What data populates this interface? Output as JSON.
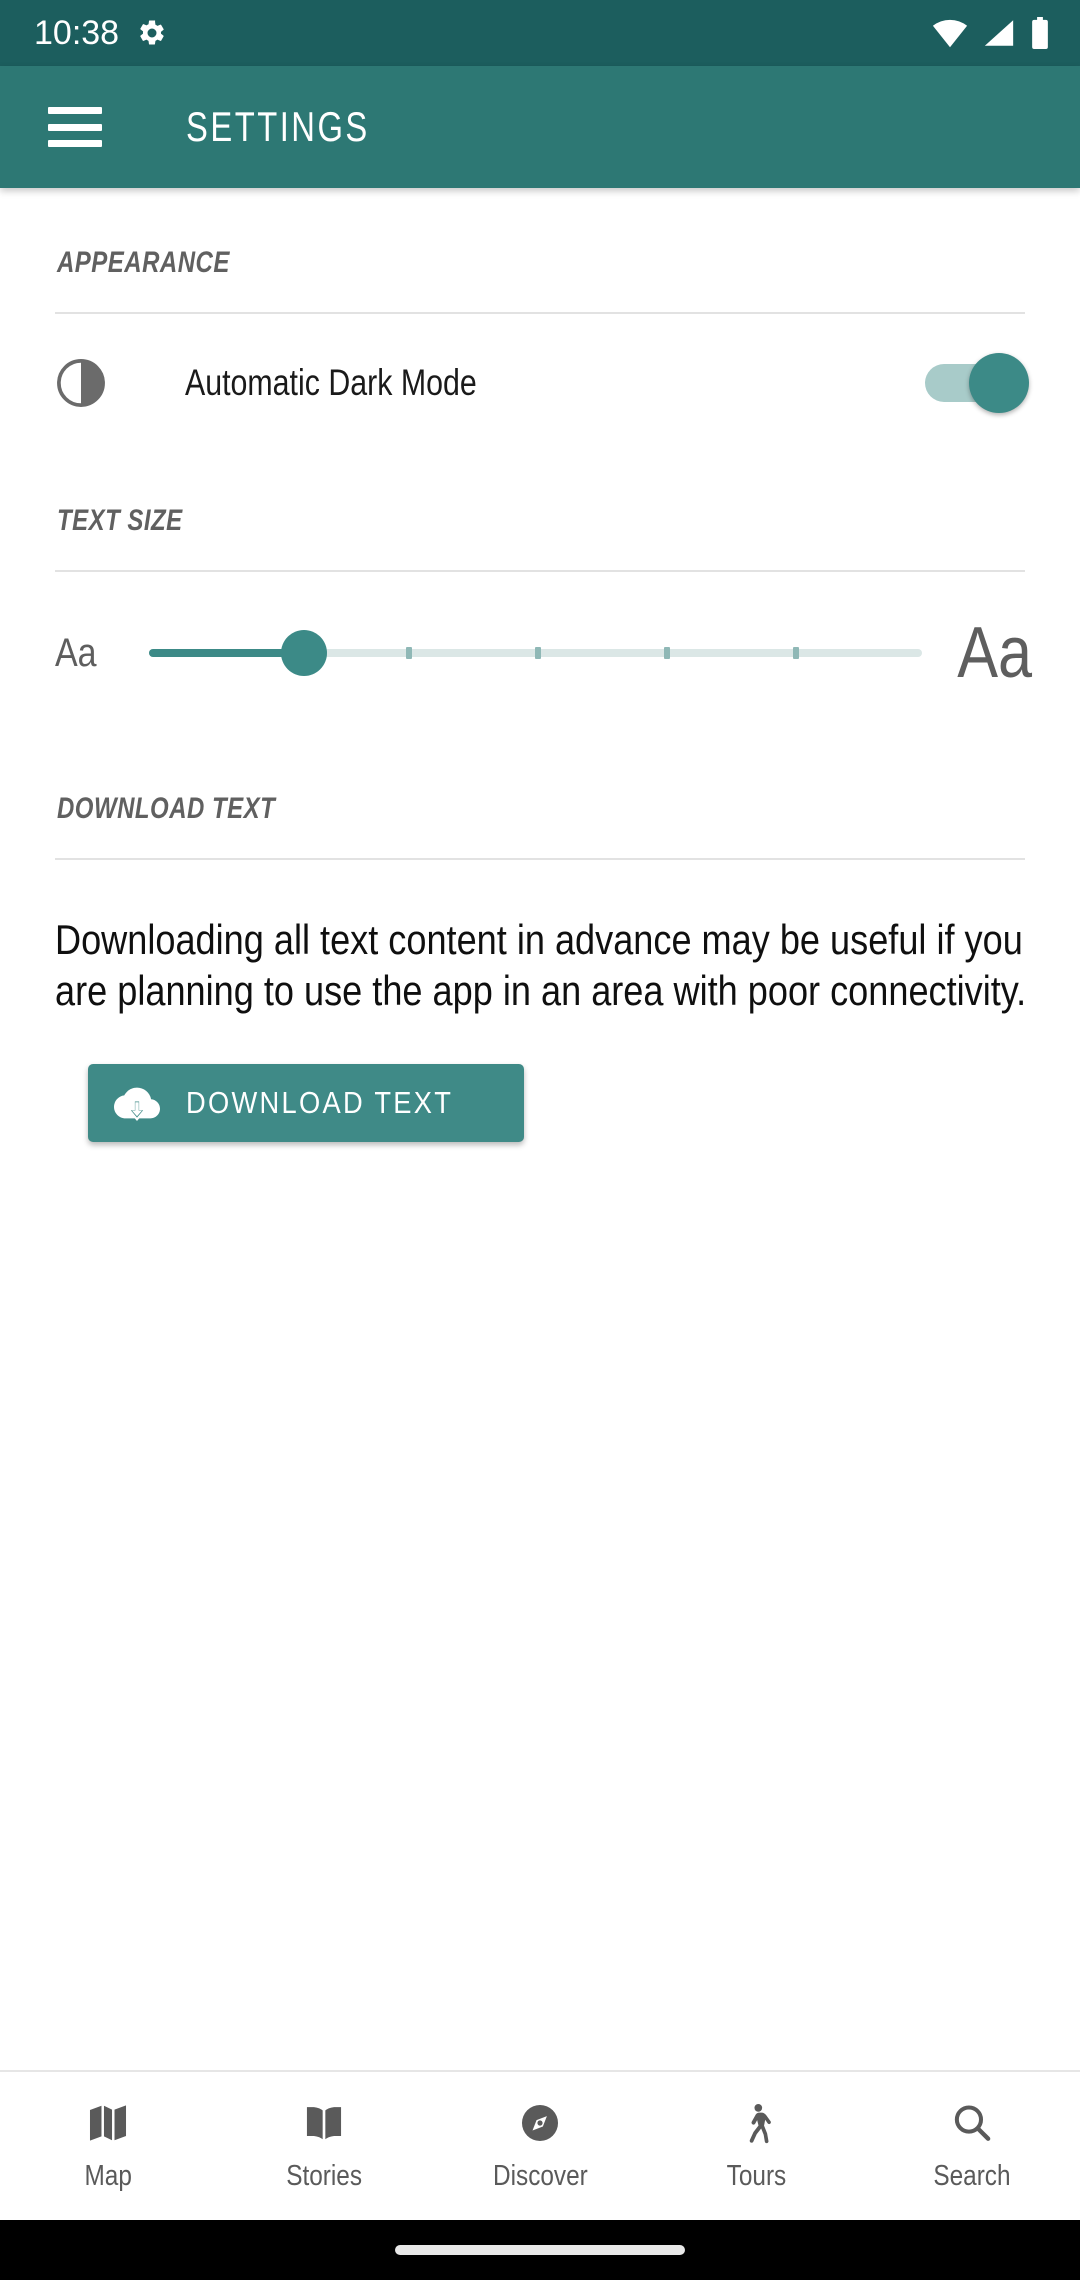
{
  "status_bar": {
    "time": "10:38",
    "icons": [
      "gear-icon",
      "wifi-icon",
      "cellular-signal-icon",
      "battery-icon"
    ],
    "background_color": "#1c5e5e"
  },
  "app_bar": {
    "menu_icon": "hamburger-menu-icon",
    "title": "SETTINGS",
    "background_color": "#2d7874"
  },
  "appearance": {
    "header": "APPEARANCE",
    "dark_mode": {
      "icon": "brightness-half-icon",
      "label": "Automatic Dark Mode",
      "enabled": true,
      "track_color": "#a8cbc9",
      "thumb_color": "#3c8a87"
    }
  },
  "text_size": {
    "header": "TEXT SIZE",
    "small_sample": "Aa",
    "large_sample": "Aa",
    "slider": {
      "value": 1,
      "min": 0,
      "max": 5,
      "steps": 6,
      "fill_color": "#3c8a87",
      "track_color": "#dbe7e6"
    }
  },
  "download_text": {
    "header": "DOWNLOAD TEXT",
    "description": "Downloading all text content in advance may be useful if you are planning to use the app in an area with poor connectivity.",
    "button": {
      "label": "DOWNLOAD TEXT",
      "icon": "cloud-download-icon",
      "background_color": "#3f8a87"
    }
  },
  "bottom_nav": {
    "items": [
      {
        "label": "Map",
        "icon": "map-icon"
      },
      {
        "label": "Stories",
        "icon": "book-icon"
      },
      {
        "label": "Discover",
        "icon": "compass-icon"
      },
      {
        "label": "Tours",
        "icon": "walking-person-icon"
      },
      {
        "label": "Search",
        "icon": "search-icon"
      }
    ],
    "inactive_color": "#5a5a5a"
  }
}
